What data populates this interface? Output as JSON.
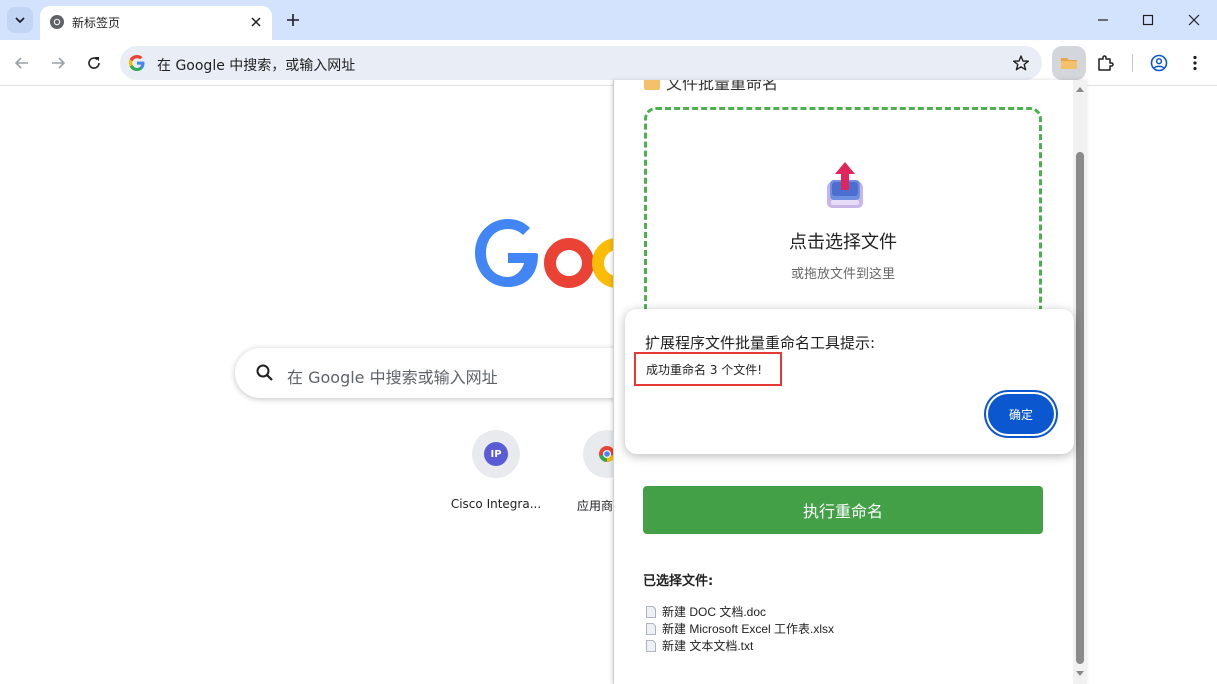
{
  "browser": {
    "tab": {
      "title": "新标签页"
    },
    "omnibox": {
      "text": "在 Google 中搜索，或输入网址"
    }
  },
  "ntp": {
    "search_placeholder": "在 Google 中搜索或输入网址",
    "shortcuts": [
      {
        "label": "Cisco Integra...",
        "initials": "IP"
      },
      {
        "label": "应用商"
      }
    ]
  },
  "popup": {
    "title": "文件批量重命名",
    "dropzone": {
      "main": "点击选择文件",
      "sub": "或拖放文件到这里"
    },
    "run_button": "执行重命名",
    "selected_title": "已选择文件:",
    "files": [
      "新建 DOC 文档.doc",
      "新建 Microsoft Excel 工作表.xlsx",
      "新建 文本文档.txt"
    ]
  },
  "dialog": {
    "title": "扩展程序文件批量重命名工具提示:",
    "message": "成功重命名 3 个文件!",
    "ok": "确定"
  },
  "colors": {
    "tabstrip": "#d3e3fd",
    "omnibox": "#e9eef6",
    "dropzone_border": "#4caf50",
    "run_button": "#43a047",
    "dialog_ok": "#0b57d0",
    "highlight_box": "#e53935"
  }
}
